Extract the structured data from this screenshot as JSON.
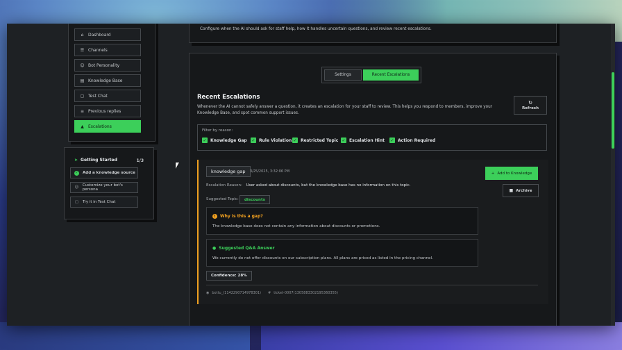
{
  "sidebar": {
    "items": [
      {
        "label": "Dashboard",
        "icon": "home-icon",
        "glyph": "⌂"
      },
      {
        "label": "Channels",
        "icon": "channels-icon",
        "glyph": "☰"
      },
      {
        "label": "Bot Personality",
        "icon": "bot-icon",
        "glyph": "☺"
      },
      {
        "label": "Knowledge Base",
        "icon": "book-icon",
        "glyph": "▤"
      },
      {
        "label": "Test Chat",
        "icon": "chat-icon",
        "glyph": "▢"
      },
      {
        "label": "Previous replies",
        "icon": "history-icon",
        "glyph": "≡"
      },
      {
        "label": "Escalations",
        "icon": "warning-icon",
        "glyph": "▲"
      }
    ],
    "active": "Escalations"
  },
  "getting_started": {
    "title": "Getting Started",
    "progress": "1/3",
    "items": [
      {
        "label": "Add a knowledge source",
        "done": true
      },
      {
        "label": "Customize your bot's persona",
        "done": false
      },
      {
        "label": "Try it in Test Chat",
        "done": false
      }
    ]
  },
  "header_panel": {
    "description": "Configure when the AI should ask for staff help, how it handles uncertain questions, and review recent escalations."
  },
  "tabs": [
    {
      "label": "Settings",
      "active": false
    },
    {
      "label": "Recent Escalations",
      "active": true
    }
  ],
  "section": {
    "title": "Recent Escalations",
    "description": "Whenever the AI cannot safely answer a question, it creates an escalation for your staff to review. This helps you respond to members, improve your Knowledge Base, and spot common support issues.",
    "refresh_label": "Refresh",
    "refresh_icon": "↻"
  },
  "filter": {
    "label": "Filter by reason:",
    "options": [
      "Knowledge Gap",
      "Rule Violation",
      "Restricted Topic",
      "Escalation Hint",
      "Action Required"
    ]
  },
  "escalation": {
    "type_badge": "knowledge gap",
    "timestamp": "3/25/2025, 3:32:06 PM",
    "reason_label": "Escalation Reason:",
    "reason": "User asked about discounts, but the knowledge base has no information on this topic.",
    "topic_label": "Suggested Topic:",
    "topic": "discounts",
    "add_button": "Add to Knowledge",
    "archive_button": "Archive",
    "gap_title": "Why is this a gap?",
    "gap_text": "The knowledge base does not contain any information about discounts or promotions.",
    "answer_title": "Suggested Q&A Answer",
    "answer_text": "We currently do not offer discounts on our subscription plans. All plans are priced as listed in the pricing channel.",
    "confidence": "Confidence: 28%",
    "footer_user": "bottu_(1142290714978301)",
    "footer_ticket": "ticket-0007(1305883302195360355)"
  },
  "colors": {
    "accent": "#3ccf5a",
    "warning": "#f0a020",
    "bg": "#1e2124"
  }
}
